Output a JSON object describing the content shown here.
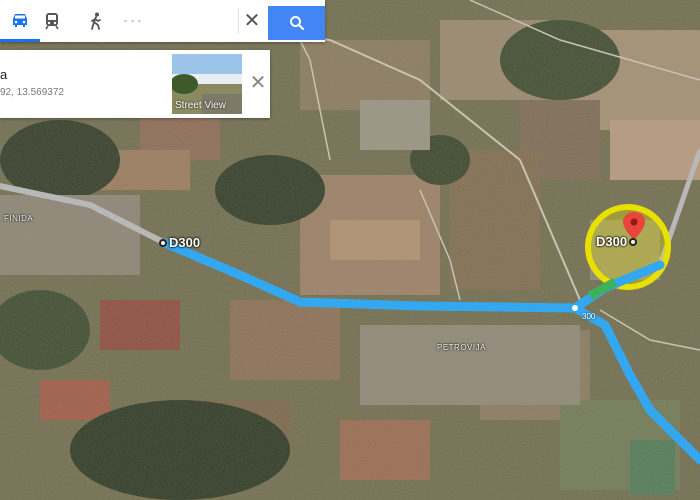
{
  "toolbar": {
    "modes": [
      "car-icon",
      "transit-icon",
      "walk-icon"
    ],
    "more_label": "···",
    "close_label": "✕",
    "accent": "#4285f4"
  },
  "info_card": {
    "name": "a",
    "coords": "92, 13.569372",
    "thumbnail_label": "Street View",
    "close_label": "✕"
  },
  "map": {
    "route_color": "#33a8f0",
    "highlight_color": "#e8e000",
    "pin_color": "#e8453c",
    "labels": {
      "road_left": "D300",
      "road_right": "D300",
      "route_number": "300",
      "town_left": "FINIDA",
      "town_center": "PETROVIJA"
    }
  }
}
